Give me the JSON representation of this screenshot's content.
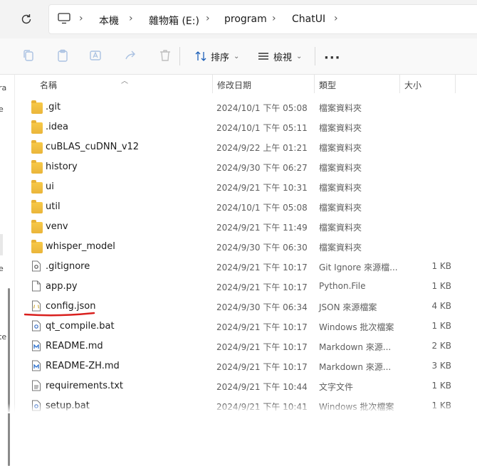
{
  "address": {
    "crumbs": [
      "本機",
      "雜物箱 (E:)",
      "program",
      "ChatUI"
    ]
  },
  "toolbar": {
    "sort_label": "排序",
    "view_label": "檢視",
    "more_label": "···"
  },
  "nav_fragments": [
    "ra",
    "e",
    "e",
    "te"
  ],
  "columns": {
    "name": "名稱",
    "date": "修改日期",
    "type": "類型",
    "size": "大小"
  },
  "files": [
    {
      "name": ".git",
      "date": "2024/10/1 下午 05:08",
      "type": "檔案資料夾",
      "size": "",
      "icon": "folder-icon"
    },
    {
      "name": ".idea",
      "date": "2024/10/1 下午 05:11",
      "type": "檔案資料夾",
      "size": "",
      "icon": "folder-icon"
    },
    {
      "name": "cuBLAS_cuDNN_v12",
      "date": "2024/9/22 上午 01:21",
      "type": "檔案資料夾",
      "size": "",
      "icon": "folder-icon"
    },
    {
      "name": "history",
      "date": "2024/9/30 下午 06:27",
      "type": "檔案資料夾",
      "size": "",
      "icon": "folder-icon"
    },
    {
      "name": "ui",
      "date": "2024/9/21 下午 10:31",
      "type": "檔案資料夾",
      "size": "",
      "icon": "folder-icon"
    },
    {
      "name": "util",
      "date": "2024/10/1 下午 05:08",
      "type": "檔案資料夾",
      "size": "",
      "icon": "folder-icon"
    },
    {
      "name": "venv",
      "date": "2024/9/21 下午 11:49",
      "type": "檔案資料夾",
      "size": "",
      "icon": "folder-icon"
    },
    {
      "name": "whisper_model",
      "date": "2024/9/30 下午 06:30",
      "type": "檔案資料夾",
      "size": "",
      "icon": "folder-icon"
    },
    {
      "name": ".gitignore",
      "date": "2024/9/21 下午 10:17",
      "type": "Git Ignore 來源檔...",
      "size": "1 KB",
      "icon": "gear-file-icon"
    },
    {
      "name": "app.py",
      "date": "2024/9/21 下午 10:17",
      "type": "Python.File",
      "size": "1 KB",
      "icon": "file-icon"
    },
    {
      "name": "config.json",
      "date": "2024/9/30 下午 06:34",
      "type": "JSON 來源檔案",
      "size": "4 KB",
      "icon": "json-file-icon"
    },
    {
      "name": "qt_compile.bat",
      "date": "2024/9/21 下午 10:17",
      "type": "Windows 批次檔案",
      "size": "1 KB",
      "icon": "bat-file-icon"
    },
    {
      "name": "README.md",
      "date": "2024/9/21 下午 10:17",
      "type": "Markdown 來源...",
      "size": "2 KB",
      "icon": "md-file-icon"
    },
    {
      "name": "README-ZH.md",
      "date": "2024/9/21 下午 10:17",
      "type": "Markdown 來源...",
      "size": "3 KB",
      "icon": "md-file-icon"
    },
    {
      "name": "requirements.txt",
      "date": "2024/9/21 下午 10:44",
      "type": "文字文件",
      "size": "1 KB",
      "icon": "text-file-icon"
    },
    {
      "name": "setup.bat",
      "date": "2024/9/21 下午 10:41",
      "type": "Windows 批次檔案",
      "size": "1 KB",
      "icon": "bat-file-icon"
    }
  ],
  "colors": {
    "folder": "#f2c03f",
    "annotation": "#d9201e"
  }
}
